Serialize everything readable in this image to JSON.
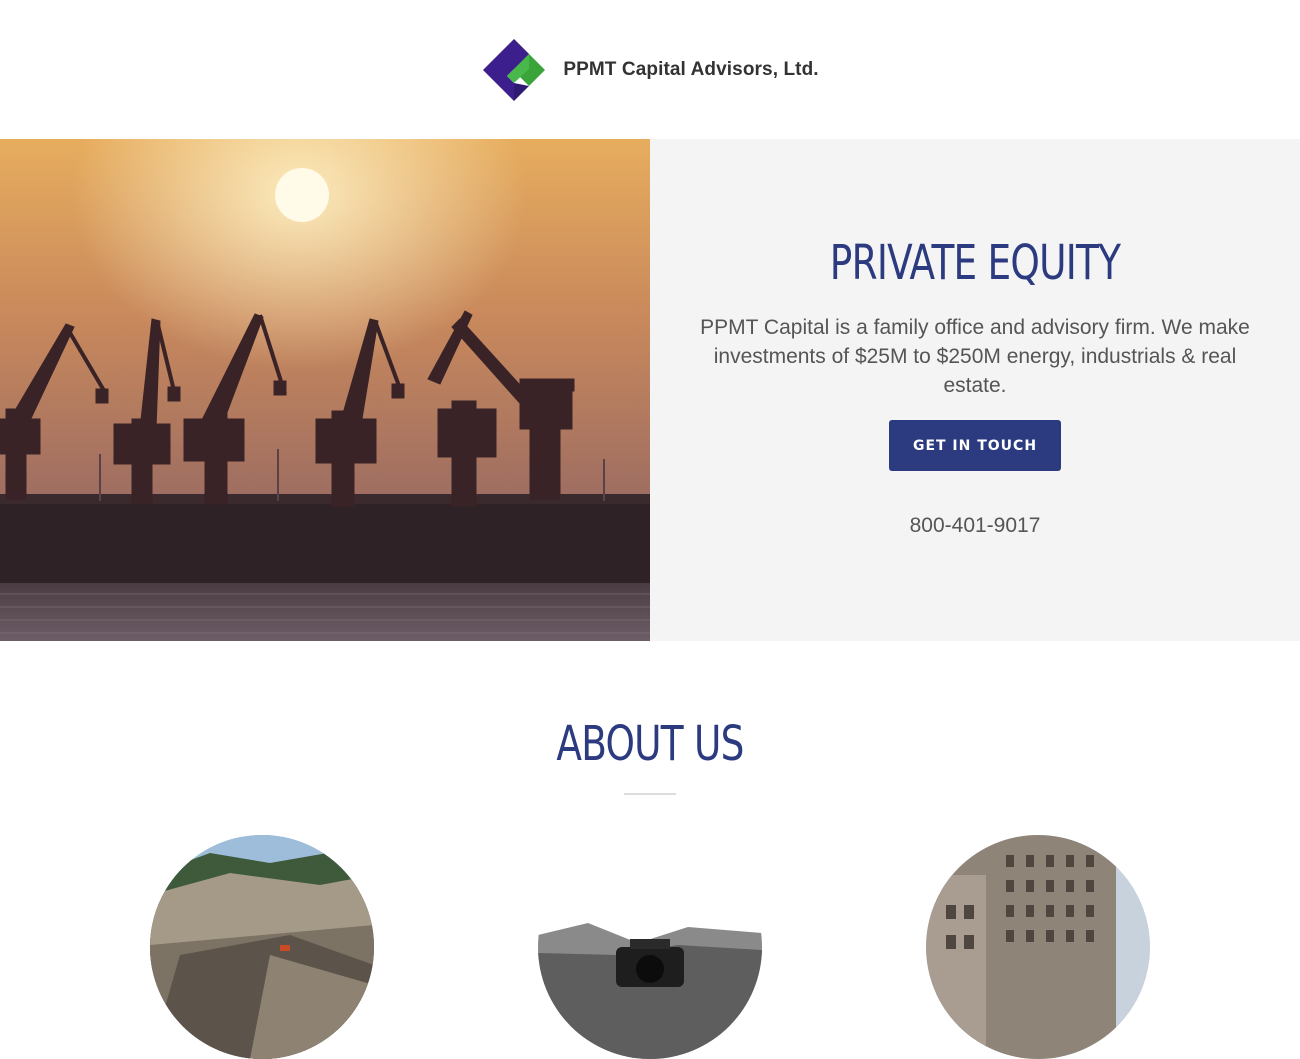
{
  "header": {
    "brand_name": "PPMT Capital Advisors, Ltd.",
    "logo_colors": {
      "green": "#3aa43b",
      "purple": "#3c1f8c"
    }
  },
  "hero": {
    "image": "sunset-port-cranes-photo",
    "title": "PRIVATE EQUITY",
    "description": "PPMT Capital is a family office and advisory firm.  We make investments of $25M to $250M energy, industrials & real estate.",
    "cta_label": "GET IN TOUCH",
    "phone": "800-401-9017",
    "accent_color": "#2c3a7f"
  },
  "about": {
    "title": "ABOUT US",
    "images": [
      "quarry-mining-photo",
      "camera-mountains-photo",
      "city-building-photo"
    ]
  }
}
